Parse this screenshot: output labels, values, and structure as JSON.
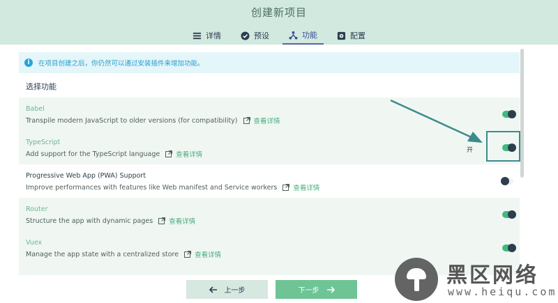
{
  "header": {
    "title": "创建新项目",
    "tabs": [
      {
        "label": "详情",
        "icon": "list-icon",
        "active": false
      },
      {
        "label": "预设",
        "icon": "check-circle-icon",
        "active": false
      },
      {
        "label": "功能",
        "icon": "fork-icon",
        "active": true
      },
      {
        "label": "配置",
        "icon": "settings-icon",
        "active": false
      }
    ]
  },
  "info": {
    "text": "在项目创建之后，你仍然可以通过安装插件来增加功能。"
  },
  "section_title": "选择功能",
  "more_label": "查看详情",
  "switch_label": "开",
  "features": [
    {
      "name": "Babel",
      "desc": "Transpile modern JavaScript to older versions (for compatibility)",
      "enabled": true
    },
    {
      "name": "TypeScript",
      "desc": "Add support for the TypeScript language",
      "enabled": true
    },
    {
      "name": "Progressive Web App (PWA) Support",
      "desc": "Improve performances with features like Web manifest and Service workers",
      "enabled": false
    },
    {
      "name": "Router",
      "desc": "Structure the app with dynamic pages",
      "enabled": true
    },
    {
      "name": "Vuex",
      "desc": "Manage the app state with a centralized store",
      "enabled": true
    }
  ],
  "footer": {
    "prev_label": "上一步",
    "next_label": "下一步"
  },
  "watermark": {
    "title": "黑区网络",
    "url": "www.heiqu.com"
  },
  "colors": {
    "header_bg": "#d1e9df",
    "accent": "#42b983",
    "info_bg": "#e4f6f9",
    "info_text": "#2a9dcd",
    "annotation": "#3d8a8a"
  }
}
